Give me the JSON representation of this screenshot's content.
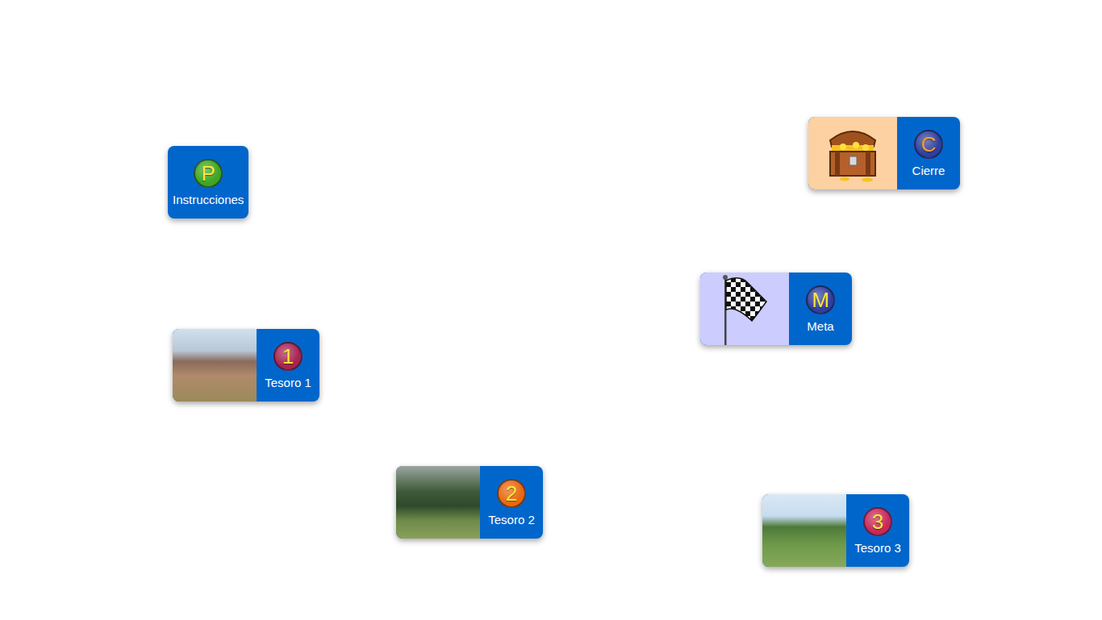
{
  "board": {
    "nodes": [
      {
        "label": "Instrucciones",
        "badge": "P",
        "kind": "plain",
        "color": "#3da623",
        "badge_text_color": "#ffe83a"
      },
      {
        "label": "Cierre",
        "badge": "C",
        "kind": "chest",
        "color": "#2e3f9e",
        "badge_text_color": "#f0a030"
      },
      {
        "label": "Meta",
        "badge": "M",
        "kind": "flag",
        "color": "#2e3f9e",
        "badge_text_color": "#ffe83a"
      },
      {
        "label": "Tesoro 1",
        "badge": "1",
        "kind": "photo",
        "color": "#a8234f",
        "badge_text_color": "#ffe83a"
      },
      {
        "label": "Tesoro 2",
        "badge": "2",
        "kind": "photo",
        "color": "#e8680c",
        "badge_text_color": "#ffe83a"
      },
      {
        "label": "Tesoro 3",
        "badge": "3",
        "kind": "photo",
        "color": "#c8285a",
        "badge_text_color": "#ffe83a"
      }
    ]
  }
}
